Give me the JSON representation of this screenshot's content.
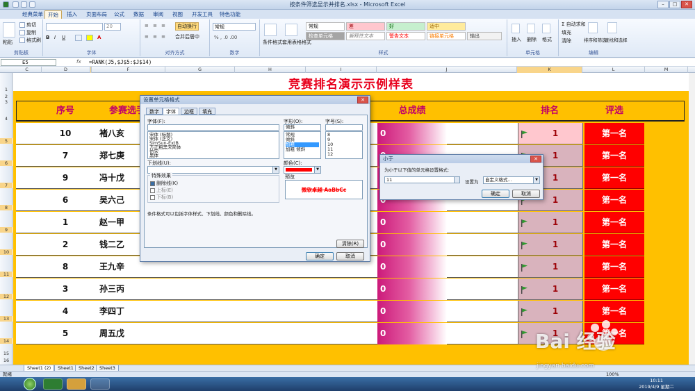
{
  "window": {
    "title": "按条件筛选显示并排名.xlsx - Microsoft Excel"
  },
  "ribbon": {
    "tabs": [
      "经典菜单",
      "开始",
      "插入",
      "页面布局",
      "公式",
      "数据",
      "审阅",
      "视图",
      "开发工具",
      "特色功能"
    ],
    "active_tab": "开始",
    "groups": {
      "clipboard": {
        "label": "剪贴板",
        "paste": "粘贴",
        "cut": "剪切",
        "copy": "复制",
        "format_painter": "格式刷"
      },
      "font": {
        "label": "字体",
        "size": "20"
      },
      "alignment": {
        "label": "对齐方式",
        "wrap": "自动换行",
        "merge": "合并后居中"
      },
      "number": {
        "label": "数字",
        "format": "常规"
      },
      "styles": {
        "label": "样式",
        "conditional": "条件格式",
        "table": "套用表格格式",
        "cells": [
          "常规",
          "差",
          "好",
          "适中",
          "检查单元格",
          "解释性文本",
          "警告文本",
          "链接单元格",
          "输出"
        ]
      },
      "cells": {
        "label": "单元格",
        "insert": "插入",
        "delete": "删除",
        "format": "格式"
      },
      "editing": {
        "label": "编辑",
        "autosum": "自动求和",
        "fill": "填充",
        "clear": "清除",
        "sort": "排序和筛选",
        "find": "查找和选择"
      }
    }
  },
  "formula_bar": {
    "name_box": "E5",
    "fx": "fx",
    "formula": "=RANK(J5,$J$5:$J$14)"
  },
  "columns": [
    "C",
    "D",
    "E",
    "F",
    "G",
    "H",
    "I",
    "J",
    "K",
    "L",
    "M"
  ],
  "rows": [
    "1",
    "2",
    "3",
    "4",
    "5",
    "6",
    "7",
    "8",
    "9",
    "10",
    "11",
    "12",
    "13",
    "14",
    "15",
    "16"
  ],
  "sheet": {
    "title": "竞赛排名演示示例样表",
    "headers": {
      "seq": "序号",
      "name": "参赛选手",
      "total": "总成绩",
      "rank": "排名",
      "eval": "评选"
    },
    "records": [
      {
        "seq": "10",
        "name": "褚八亥",
        "total": "0",
        "rank": "1",
        "eval": "第一名"
      },
      {
        "seq": "7",
        "name": "郑七庚",
        "total": "0",
        "rank": "1",
        "eval": "第一名"
      },
      {
        "seq": "9",
        "name": "冯十戊",
        "total": "0",
        "rank": "1",
        "eval": "第一名"
      },
      {
        "seq": "6",
        "name": "吴六己",
        "total": "0",
        "rank": "1",
        "eval": "第一名"
      },
      {
        "seq": "1",
        "name": "赵一甲",
        "total": "0",
        "rank": "1",
        "eval": "第一名"
      },
      {
        "seq": "2",
        "name": "钱二乙",
        "total": "0",
        "rank": "1",
        "eval": "第一名"
      },
      {
        "seq": "8",
        "name": "王九辛",
        "total": "0",
        "rank": "1",
        "eval": "第一名"
      },
      {
        "seq": "3",
        "name": "孙三丙",
        "total": "0",
        "rank": "1",
        "eval": "第一名"
      },
      {
        "seq": "4",
        "name": "李四丁",
        "total": "0",
        "rank": "1",
        "eval": "第一名"
      },
      {
        "seq": "5",
        "name": "周五戊",
        "total": "0",
        "rank": "1",
        "eval": "第一名"
      }
    ]
  },
  "sheet_tabs": [
    "Sheet1 (2)",
    "Sheet1",
    "Sheet2",
    "Sheet3"
  ],
  "status": {
    "mode": "就绪",
    "zoom": "100%"
  },
  "format_dialog": {
    "title": "设置单元格格式",
    "tabs": [
      "数字",
      "字体",
      "边框",
      "填充"
    ],
    "active_tab": "字体",
    "font_label": "字体(F):",
    "font_list": [
      "宋体 (标题)",
      "宋体 (正文)",
      "SimSun-ExtB",
      "方正粗黑宋简体",
      "仿宋",
      "黑体"
    ],
    "style_label": "字形(O):",
    "style_value": "倾斜",
    "style_list": [
      "常规",
      "倾斜",
      "加粗",
      "加粗 倾斜"
    ],
    "size_label": "字号(S):",
    "size_list": [
      "8",
      "9",
      "10",
      "11",
      "12"
    ],
    "underline_label": "下划线(U):",
    "color_label": "颜色(C):",
    "color_value": "#ff0000",
    "effects_label": "特殊效果",
    "strike_label": "删除线(K)",
    "super_label": "上标(E)",
    "sub_label": "下标(B)",
    "preview_label": "预览",
    "preview_text": "微软卓越  AaBbCc",
    "hint": "条件格式可以包括字体样式、下划线、颜色和删除线。",
    "clear_btn": "清除(R)",
    "ok": "确定",
    "cancel": "取消"
  },
  "less_dialog": {
    "title": "小于",
    "prompt": "为小于以下值的单元格设置格式:",
    "value": "11",
    "set_as": "设置为",
    "format_value": "自定义格式...",
    "ok": "确定",
    "cancel": "取消"
  },
  "taskbar": {
    "time": "10:11",
    "date": "2019/4/9 星期二"
  },
  "watermark": {
    "brand": "Bai  经验",
    "url": "jingyan.baidu.com"
  },
  "colors": {
    "title_red": "#e8001c",
    "header_yellow": "#ffc000",
    "rank_fill": "#ffc7ce",
    "eval_red": "#ff0000",
    "bar_magenta": "#cc1a7a"
  }
}
